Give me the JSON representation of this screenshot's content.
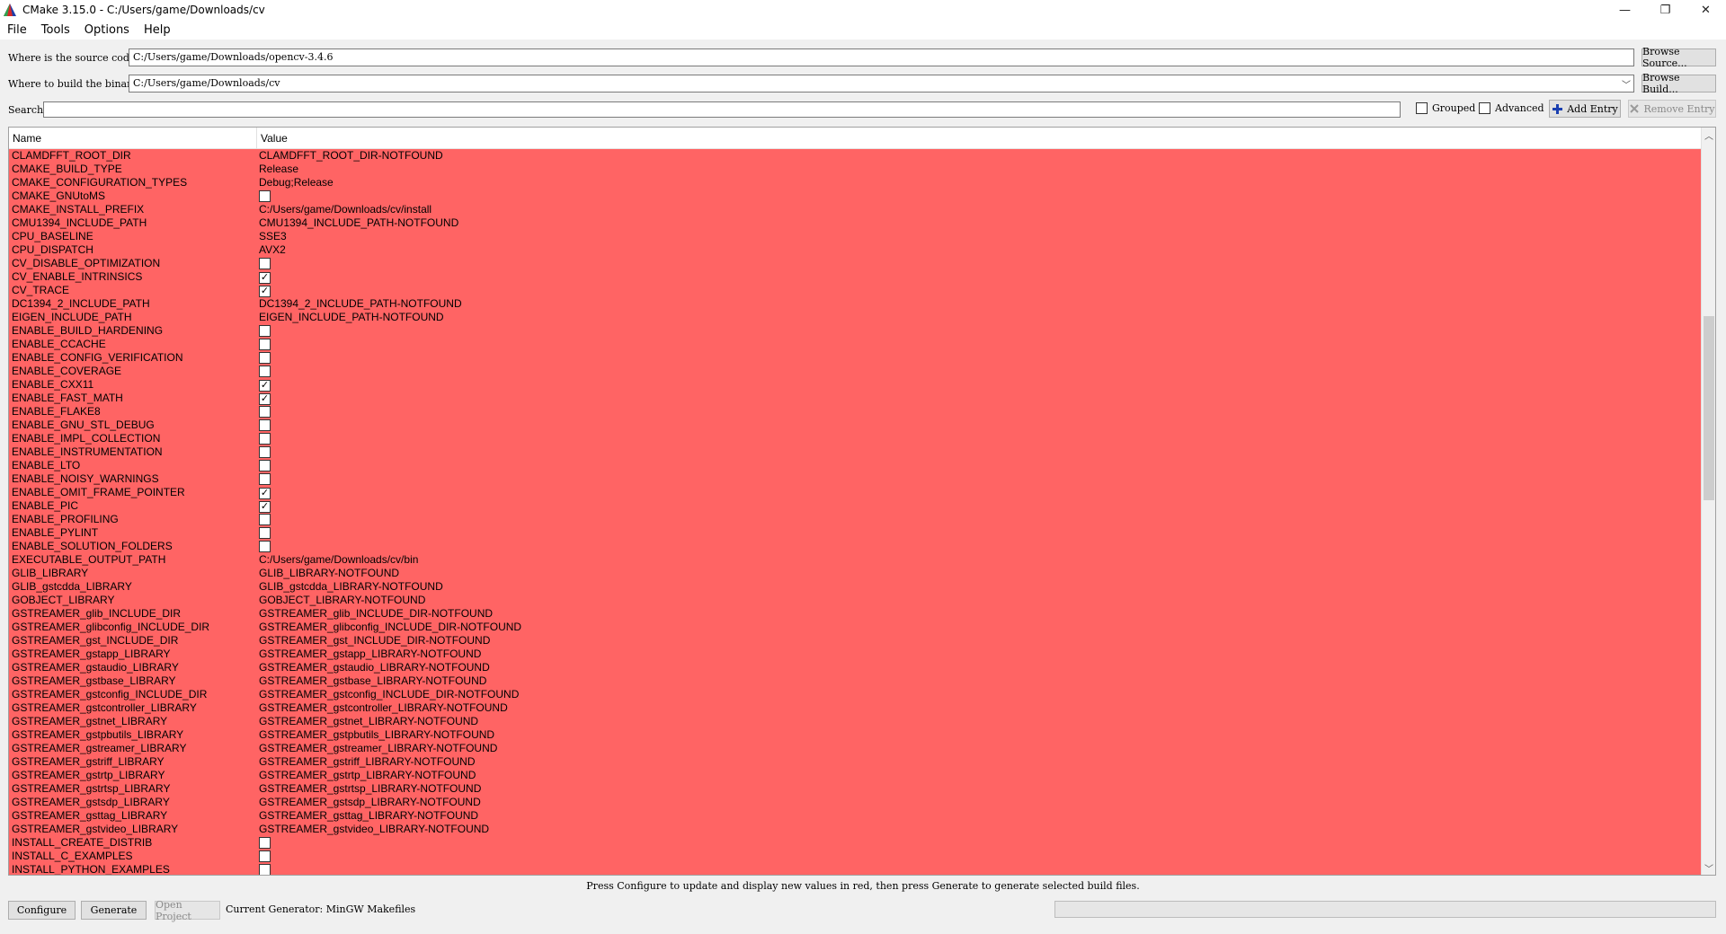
{
  "window": {
    "title": "CMake 3.15.0 - C:/Users/game/Downloads/cv",
    "minimize": "—",
    "maximize": "❐",
    "close": "✕"
  },
  "menu": [
    "File",
    "Tools",
    "Options",
    "Help"
  ],
  "source": {
    "label": "Where is the source code:",
    "value": "C:/Users/game/Downloads/opencv-3.4.6",
    "browse": "Browse Source..."
  },
  "build": {
    "label": "Where to build the binaries:",
    "value": "C:/Users/game/Downloads/cv",
    "browse": "Browse Build..."
  },
  "search": {
    "label": "Search:",
    "value": ""
  },
  "options": {
    "grouped": "Grouped",
    "grouped_checked": false,
    "advanced": "Advanced",
    "advanced_checked": false,
    "add_entry": "Add Entry",
    "remove_entry": "Remove Entry"
  },
  "table": {
    "headers": {
      "name": "Name",
      "value": "Value"
    },
    "row_color": "#ff6464",
    "rows": [
      {
        "name": "CLAMDFFT_ROOT_DIR",
        "value": "CLAMDFFT_ROOT_DIR-NOTFOUND"
      },
      {
        "name": "CMAKE_BUILD_TYPE",
        "value": "Release"
      },
      {
        "name": "CMAKE_CONFIGURATION_TYPES",
        "value": "Debug;Release"
      },
      {
        "name": "CMAKE_GNUtoMS",
        "bool": false
      },
      {
        "name": "CMAKE_INSTALL_PREFIX",
        "value": "C:/Users/game/Downloads/cv/install"
      },
      {
        "name": "CMU1394_INCLUDE_PATH",
        "value": "CMU1394_INCLUDE_PATH-NOTFOUND"
      },
      {
        "name": "CPU_BASELINE",
        "value": "SSE3"
      },
      {
        "name": "CPU_DISPATCH",
        "value": "AVX2"
      },
      {
        "name": "CV_DISABLE_OPTIMIZATION",
        "bool": false
      },
      {
        "name": "CV_ENABLE_INTRINSICS",
        "bool": true
      },
      {
        "name": "CV_TRACE",
        "bool": true
      },
      {
        "name": "DC1394_2_INCLUDE_PATH",
        "value": "DC1394_2_INCLUDE_PATH-NOTFOUND"
      },
      {
        "name": "EIGEN_INCLUDE_PATH",
        "value": "EIGEN_INCLUDE_PATH-NOTFOUND"
      },
      {
        "name": "ENABLE_BUILD_HARDENING",
        "bool": false
      },
      {
        "name": "ENABLE_CCACHE",
        "bool": false
      },
      {
        "name": "ENABLE_CONFIG_VERIFICATION",
        "bool": false
      },
      {
        "name": "ENABLE_COVERAGE",
        "bool": false
      },
      {
        "name": "ENABLE_CXX11",
        "bool": true
      },
      {
        "name": "ENABLE_FAST_MATH",
        "bool": true
      },
      {
        "name": "ENABLE_FLAKE8",
        "bool": false
      },
      {
        "name": "ENABLE_GNU_STL_DEBUG",
        "bool": false
      },
      {
        "name": "ENABLE_IMPL_COLLECTION",
        "bool": false
      },
      {
        "name": "ENABLE_INSTRUMENTATION",
        "bool": false
      },
      {
        "name": "ENABLE_LTO",
        "bool": false
      },
      {
        "name": "ENABLE_NOISY_WARNINGS",
        "bool": false
      },
      {
        "name": "ENABLE_OMIT_FRAME_POINTER",
        "bool": true
      },
      {
        "name": "ENABLE_PIC",
        "bool": true
      },
      {
        "name": "ENABLE_PROFILING",
        "bool": false
      },
      {
        "name": "ENABLE_PYLINT",
        "bool": false
      },
      {
        "name": "ENABLE_SOLUTION_FOLDERS",
        "bool": false
      },
      {
        "name": "EXECUTABLE_OUTPUT_PATH",
        "value": "C:/Users/game/Downloads/cv/bin"
      },
      {
        "name": "GLIB_LIBRARY",
        "value": "GLIB_LIBRARY-NOTFOUND"
      },
      {
        "name": "GLIB_gstcdda_LIBRARY",
        "value": "GLIB_gstcdda_LIBRARY-NOTFOUND"
      },
      {
        "name": "GOBJECT_LIBRARY",
        "value": "GOBJECT_LIBRARY-NOTFOUND"
      },
      {
        "name": "GSTREAMER_glib_INCLUDE_DIR",
        "value": "GSTREAMER_glib_INCLUDE_DIR-NOTFOUND"
      },
      {
        "name": "GSTREAMER_glibconfig_INCLUDE_DIR",
        "value": "GSTREAMER_glibconfig_INCLUDE_DIR-NOTFOUND"
      },
      {
        "name": "GSTREAMER_gst_INCLUDE_DIR",
        "value": "GSTREAMER_gst_INCLUDE_DIR-NOTFOUND"
      },
      {
        "name": "GSTREAMER_gstapp_LIBRARY",
        "value": "GSTREAMER_gstapp_LIBRARY-NOTFOUND"
      },
      {
        "name": "GSTREAMER_gstaudio_LIBRARY",
        "value": "GSTREAMER_gstaudio_LIBRARY-NOTFOUND"
      },
      {
        "name": "GSTREAMER_gstbase_LIBRARY",
        "value": "GSTREAMER_gstbase_LIBRARY-NOTFOUND"
      },
      {
        "name": "GSTREAMER_gstconfig_INCLUDE_DIR",
        "value": "GSTREAMER_gstconfig_INCLUDE_DIR-NOTFOUND"
      },
      {
        "name": "GSTREAMER_gstcontroller_LIBRARY",
        "value": "GSTREAMER_gstcontroller_LIBRARY-NOTFOUND"
      },
      {
        "name": "GSTREAMER_gstnet_LIBRARY",
        "value": "GSTREAMER_gstnet_LIBRARY-NOTFOUND"
      },
      {
        "name": "GSTREAMER_gstpbutils_LIBRARY",
        "value": "GSTREAMER_gstpbutils_LIBRARY-NOTFOUND"
      },
      {
        "name": "GSTREAMER_gstreamer_LIBRARY",
        "value": "GSTREAMER_gstreamer_LIBRARY-NOTFOUND"
      },
      {
        "name": "GSTREAMER_gstriff_LIBRARY",
        "value": "GSTREAMER_gstriff_LIBRARY-NOTFOUND"
      },
      {
        "name": "GSTREAMER_gstrtp_LIBRARY",
        "value": "GSTREAMER_gstrtp_LIBRARY-NOTFOUND"
      },
      {
        "name": "GSTREAMER_gstrtsp_LIBRARY",
        "value": "GSTREAMER_gstrtsp_LIBRARY-NOTFOUND"
      },
      {
        "name": "GSTREAMER_gstsdp_LIBRARY",
        "value": "GSTREAMER_gstsdp_LIBRARY-NOTFOUND"
      },
      {
        "name": "GSTREAMER_gsttag_LIBRARY",
        "value": "GSTREAMER_gsttag_LIBRARY-NOTFOUND"
      },
      {
        "name": "GSTREAMER_gstvideo_LIBRARY",
        "value": "GSTREAMER_gstvideo_LIBRARY-NOTFOUND"
      },
      {
        "name": "INSTALL_CREATE_DISTRIB",
        "bool": false
      },
      {
        "name": "INSTALL_C_EXAMPLES",
        "bool": false
      },
      {
        "name": "INSTALL_PYTHON_EXAMPLES",
        "bool": false
      }
    ]
  },
  "status": {
    "message": "Press Configure to update and display new values in red, then press Generate to generate selected build files."
  },
  "bottom": {
    "configure": "Configure",
    "generate": "Generate",
    "open_project": "Open Project",
    "generator": "Current Generator: MinGW Makefiles"
  }
}
